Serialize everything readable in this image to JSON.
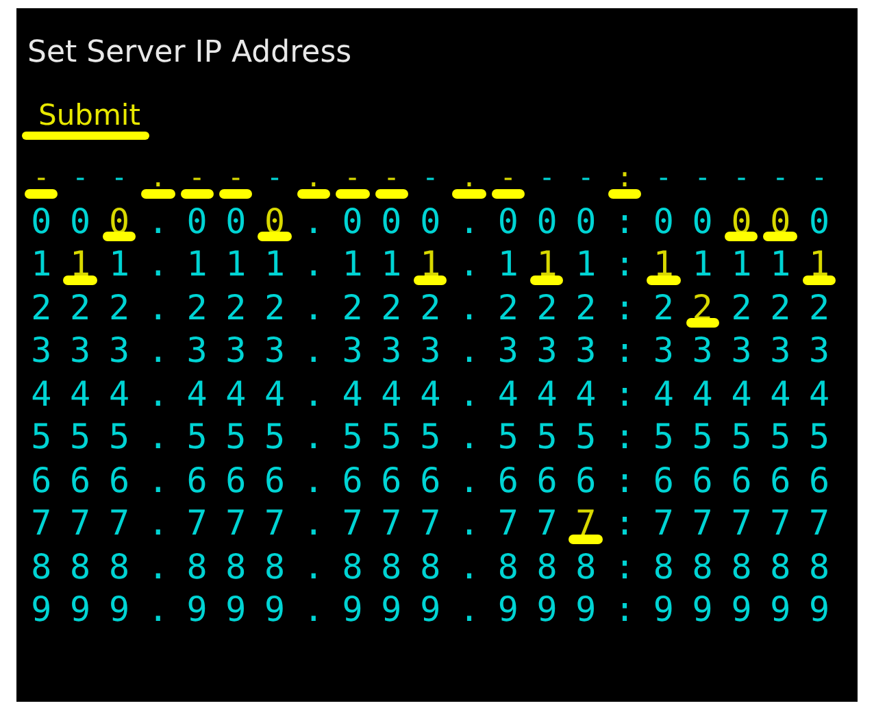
{
  "title": "Set Server IP Address",
  "submit": {
    "label": "Submit"
  },
  "columns": [
    {
      "kind": "digit",
      "mark": "-",
      "marked": true,
      "digits": [
        {
          "text": "0",
          "selected": false
        },
        {
          "text": "1",
          "selected": false
        },
        {
          "text": "2",
          "selected": false
        },
        {
          "text": "3",
          "selected": false
        },
        {
          "text": "4",
          "selected": false
        },
        {
          "text": "5",
          "selected": false
        },
        {
          "text": "6",
          "selected": false
        },
        {
          "text": "7",
          "selected": false
        },
        {
          "text": "8",
          "selected": false
        },
        {
          "text": "9",
          "selected": false
        }
      ]
    },
    {
      "kind": "digit",
      "mark": "-",
      "marked": false,
      "digits": [
        {
          "text": "0",
          "selected": false
        },
        {
          "text": "1",
          "selected": true
        },
        {
          "text": "2",
          "selected": false
        },
        {
          "text": "3",
          "selected": false
        },
        {
          "text": "4",
          "selected": false
        },
        {
          "text": "5",
          "selected": false
        },
        {
          "text": "6",
          "selected": false
        },
        {
          "text": "7",
          "selected": false
        },
        {
          "text": "8",
          "selected": false
        },
        {
          "text": "9",
          "selected": false
        }
      ]
    },
    {
      "kind": "digit",
      "mark": "-",
      "marked": false,
      "digits": [
        {
          "text": "0",
          "selected": true
        },
        {
          "text": "1",
          "selected": false
        },
        {
          "text": "2",
          "selected": false
        },
        {
          "text": "3",
          "selected": false
        },
        {
          "text": "4",
          "selected": false
        },
        {
          "text": "5",
          "selected": false
        },
        {
          "text": "6",
          "selected": false
        },
        {
          "text": "7",
          "selected": false
        },
        {
          "text": "8",
          "selected": false
        },
        {
          "text": "9",
          "selected": false
        }
      ]
    },
    {
      "kind": "separator",
      "mark": ".",
      "marked": true,
      "glyphs": [
        ".",
        ".",
        ".",
        ".",
        ".",
        ".",
        ".",
        ".",
        ".",
        "."
      ]
    },
    {
      "kind": "digit",
      "mark": "-",
      "marked": true,
      "digits": [
        {
          "text": "0",
          "selected": false
        },
        {
          "text": "1",
          "selected": false
        },
        {
          "text": "2",
          "selected": false
        },
        {
          "text": "3",
          "selected": false
        },
        {
          "text": "4",
          "selected": false
        },
        {
          "text": "5",
          "selected": false
        },
        {
          "text": "6",
          "selected": false
        },
        {
          "text": "7",
          "selected": false
        },
        {
          "text": "8",
          "selected": false
        },
        {
          "text": "9",
          "selected": false
        }
      ]
    },
    {
      "kind": "digit",
      "mark": "-",
      "marked": true,
      "digits": [
        {
          "text": "0",
          "selected": false
        },
        {
          "text": "1",
          "selected": false
        },
        {
          "text": "2",
          "selected": false
        },
        {
          "text": "3",
          "selected": false
        },
        {
          "text": "4",
          "selected": false
        },
        {
          "text": "5",
          "selected": false
        },
        {
          "text": "6",
          "selected": false
        },
        {
          "text": "7",
          "selected": false
        },
        {
          "text": "8",
          "selected": false
        },
        {
          "text": "9",
          "selected": false
        }
      ]
    },
    {
      "kind": "digit",
      "mark": "-",
      "marked": false,
      "digits": [
        {
          "text": "0",
          "selected": true
        },
        {
          "text": "1",
          "selected": false
        },
        {
          "text": "2",
          "selected": false
        },
        {
          "text": "3",
          "selected": false
        },
        {
          "text": "4",
          "selected": false
        },
        {
          "text": "5",
          "selected": false
        },
        {
          "text": "6",
          "selected": false
        },
        {
          "text": "7",
          "selected": false
        },
        {
          "text": "8",
          "selected": false
        },
        {
          "text": "9",
          "selected": false
        }
      ]
    },
    {
      "kind": "separator",
      "mark": ".",
      "marked": true,
      "glyphs": [
        ".",
        ".",
        ".",
        ".",
        ".",
        ".",
        ".",
        ".",
        ".",
        "."
      ]
    },
    {
      "kind": "digit",
      "mark": "-",
      "marked": true,
      "digits": [
        {
          "text": "0",
          "selected": false
        },
        {
          "text": "1",
          "selected": false
        },
        {
          "text": "2",
          "selected": false
        },
        {
          "text": "3",
          "selected": false
        },
        {
          "text": "4",
          "selected": false
        },
        {
          "text": "5",
          "selected": false
        },
        {
          "text": "6",
          "selected": false
        },
        {
          "text": "7",
          "selected": false
        },
        {
          "text": "8",
          "selected": false
        },
        {
          "text": "9",
          "selected": false
        }
      ]
    },
    {
      "kind": "digit",
      "mark": "-",
      "marked": true,
      "digits": [
        {
          "text": "0",
          "selected": false
        },
        {
          "text": "1",
          "selected": false
        },
        {
          "text": "2",
          "selected": false
        },
        {
          "text": "3",
          "selected": false
        },
        {
          "text": "4",
          "selected": false
        },
        {
          "text": "5",
          "selected": false
        },
        {
          "text": "6",
          "selected": false
        },
        {
          "text": "7",
          "selected": false
        },
        {
          "text": "8",
          "selected": false
        },
        {
          "text": "9",
          "selected": false
        }
      ]
    },
    {
      "kind": "digit",
      "mark": "-",
      "marked": false,
      "digits": [
        {
          "text": "0",
          "selected": false
        },
        {
          "text": "1",
          "selected": true
        },
        {
          "text": "2",
          "selected": false
        },
        {
          "text": "3",
          "selected": false
        },
        {
          "text": "4",
          "selected": false
        },
        {
          "text": "5",
          "selected": false
        },
        {
          "text": "6",
          "selected": false
        },
        {
          "text": "7",
          "selected": false
        },
        {
          "text": "8",
          "selected": false
        },
        {
          "text": "9",
          "selected": false
        }
      ]
    },
    {
      "kind": "separator",
      "mark": ".",
      "marked": true,
      "glyphs": [
        ".",
        ".",
        ".",
        ".",
        ".",
        ".",
        ".",
        ".",
        ".",
        "."
      ]
    },
    {
      "kind": "digit",
      "mark": "-",
      "marked": true,
      "digits": [
        {
          "text": "0",
          "selected": false
        },
        {
          "text": "1",
          "selected": false
        },
        {
          "text": "2",
          "selected": false
        },
        {
          "text": "3",
          "selected": false
        },
        {
          "text": "4",
          "selected": false
        },
        {
          "text": "5",
          "selected": false
        },
        {
          "text": "6",
          "selected": false
        },
        {
          "text": "7",
          "selected": false
        },
        {
          "text": "8",
          "selected": false
        },
        {
          "text": "9",
          "selected": false
        }
      ]
    },
    {
      "kind": "digit",
      "mark": "-",
      "marked": false,
      "digits": [
        {
          "text": "0",
          "selected": false
        },
        {
          "text": "1",
          "selected": true
        },
        {
          "text": "2",
          "selected": false
        },
        {
          "text": "3",
          "selected": false
        },
        {
          "text": "4",
          "selected": false
        },
        {
          "text": "5",
          "selected": false
        },
        {
          "text": "6",
          "selected": false
        },
        {
          "text": "7",
          "selected": false
        },
        {
          "text": "8",
          "selected": false
        },
        {
          "text": "9",
          "selected": false
        }
      ]
    },
    {
      "kind": "digit",
      "mark": "-",
      "marked": false,
      "digits": [
        {
          "text": "0",
          "selected": false
        },
        {
          "text": "1",
          "selected": false
        },
        {
          "text": "2",
          "selected": false
        },
        {
          "text": "3",
          "selected": false
        },
        {
          "text": "4",
          "selected": false
        },
        {
          "text": "5",
          "selected": false
        },
        {
          "text": "6",
          "selected": false
        },
        {
          "text": "7",
          "selected": true
        },
        {
          "text": "8",
          "selected": false
        },
        {
          "text": "9",
          "selected": false
        }
      ]
    },
    {
      "kind": "separator",
      "mark": ":",
      "marked": true,
      "glyphs": [
        ":",
        ":",
        ":",
        ":",
        ":",
        ":",
        ":",
        ":",
        ":",
        ":"
      ]
    },
    {
      "kind": "digit",
      "mark": "-",
      "marked": false,
      "digits": [
        {
          "text": "0",
          "selected": false
        },
        {
          "text": "1",
          "selected": true
        },
        {
          "text": "2",
          "selected": false
        },
        {
          "text": "3",
          "selected": false
        },
        {
          "text": "4",
          "selected": false
        },
        {
          "text": "5",
          "selected": false
        },
        {
          "text": "6",
          "selected": false
        },
        {
          "text": "7",
          "selected": false
        },
        {
          "text": "8",
          "selected": false
        },
        {
          "text": "9",
          "selected": false
        }
      ]
    },
    {
      "kind": "digit",
      "mark": "-",
      "marked": false,
      "digits": [
        {
          "text": "0",
          "selected": false
        },
        {
          "text": "1",
          "selected": false
        },
        {
          "text": "2",
          "selected": true
        },
        {
          "text": "3",
          "selected": false
        },
        {
          "text": "4",
          "selected": false
        },
        {
          "text": "5",
          "selected": false
        },
        {
          "text": "6",
          "selected": false
        },
        {
          "text": "7",
          "selected": false
        },
        {
          "text": "8",
          "selected": false
        },
        {
          "text": "9",
          "selected": false
        }
      ]
    },
    {
      "kind": "digit",
      "mark": "-",
      "marked": false,
      "digits": [
        {
          "text": "0",
          "selected": true
        },
        {
          "text": "1",
          "selected": false
        },
        {
          "text": "2",
          "selected": false
        },
        {
          "text": "3",
          "selected": false
        },
        {
          "text": "4",
          "selected": false
        },
        {
          "text": "5",
          "selected": false
        },
        {
          "text": "6",
          "selected": false
        },
        {
          "text": "7",
          "selected": false
        },
        {
          "text": "8",
          "selected": false
        },
        {
          "text": "9",
          "selected": false
        }
      ]
    },
    {
      "kind": "digit",
      "mark": "-",
      "marked": false,
      "digits": [
        {
          "text": "0",
          "selected": true
        },
        {
          "text": "1",
          "selected": false
        },
        {
          "text": "2",
          "selected": false
        },
        {
          "text": "3",
          "selected": false
        },
        {
          "text": "4",
          "selected": false
        },
        {
          "text": "5",
          "selected": false
        },
        {
          "text": "6",
          "selected": false
        },
        {
          "text": "7",
          "selected": false
        },
        {
          "text": "8",
          "selected": false
        },
        {
          "text": "9",
          "selected": false
        }
      ]
    },
    {
      "kind": "digit",
      "mark": "-",
      "marked": false,
      "digits": [
        {
          "text": "0",
          "selected": false
        },
        {
          "text": "1",
          "selected": true
        },
        {
          "text": "2",
          "selected": false
        },
        {
          "text": "3",
          "selected": false
        },
        {
          "text": "4",
          "selected": false
        },
        {
          "text": "5",
          "selected": false
        },
        {
          "text": "6",
          "selected": false
        },
        {
          "text": "7",
          "selected": false
        },
        {
          "text": "8",
          "selected": false
        },
        {
          "text": "9",
          "selected": false
        }
      ]
    }
  ]
}
